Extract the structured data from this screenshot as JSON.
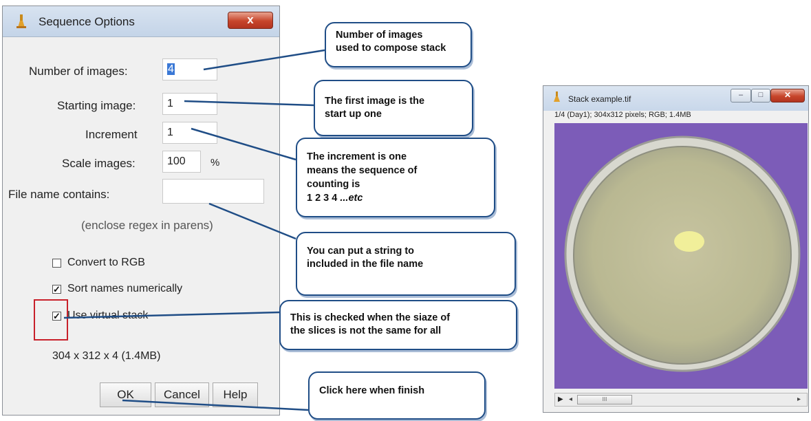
{
  "dialog": {
    "title": "Sequence Options",
    "close_glyph": "x",
    "fields": {
      "number_of_images_label": "Number of images:",
      "number_of_images_value": "4",
      "starting_image_label": "Starting image:",
      "starting_image_value": "1",
      "increment_label": "Increment",
      "increment_value": "1",
      "scale_images_label": "Scale images:",
      "scale_images_value": "100",
      "scale_unit": "%",
      "file_name_label": "File name contains:",
      "file_name_value": "",
      "regex_hint": "(enclose regex in parens)"
    },
    "checkboxes": {
      "convert_rgb_label": "Convert to RGB",
      "convert_rgb_checked": false,
      "sort_numeric_label": "Sort names numerically",
      "sort_numeric_checked": true,
      "virtual_stack_label": "Use virtual stack",
      "virtual_stack_checked": true
    },
    "summary": "304 x 312 x 4 (1.4MB)",
    "buttons": {
      "ok": "OK",
      "cancel": "Cancel",
      "help": "Help"
    }
  },
  "callouts": {
    "number_images": [
      "Number of images",
      "used to compose stack"
    ],
    "first_image": [
      "The first image is the",
      "start up one"
    ],
    "increment": [
      "The increment is one",
      "means the sequence of",
      "counting is"
    ],
    "increment_sequence": "1  2  3  4",
    "increment_etc": " ...etc",
    "string": [
      "You can put a string to",
      "included in the file name"
    ],
    "virtual": [
      "This is checked when the siaze of",
      "the slices is not the same for all"
    ],
    "ok": "Click here when finish"
  },
  "stack_window": {
    "title": "Stack example.tif",
    "info": "1/4 (Day1); 304x312 pixels; RGB; 1.4MB",
    "scroll_thumb": "III"
  },
  "colors": {
    "callout_border": "#1f4d86",
    "highlight_box": "#c8202a",
    "image_background": "#7c5cb8"
  }
}
